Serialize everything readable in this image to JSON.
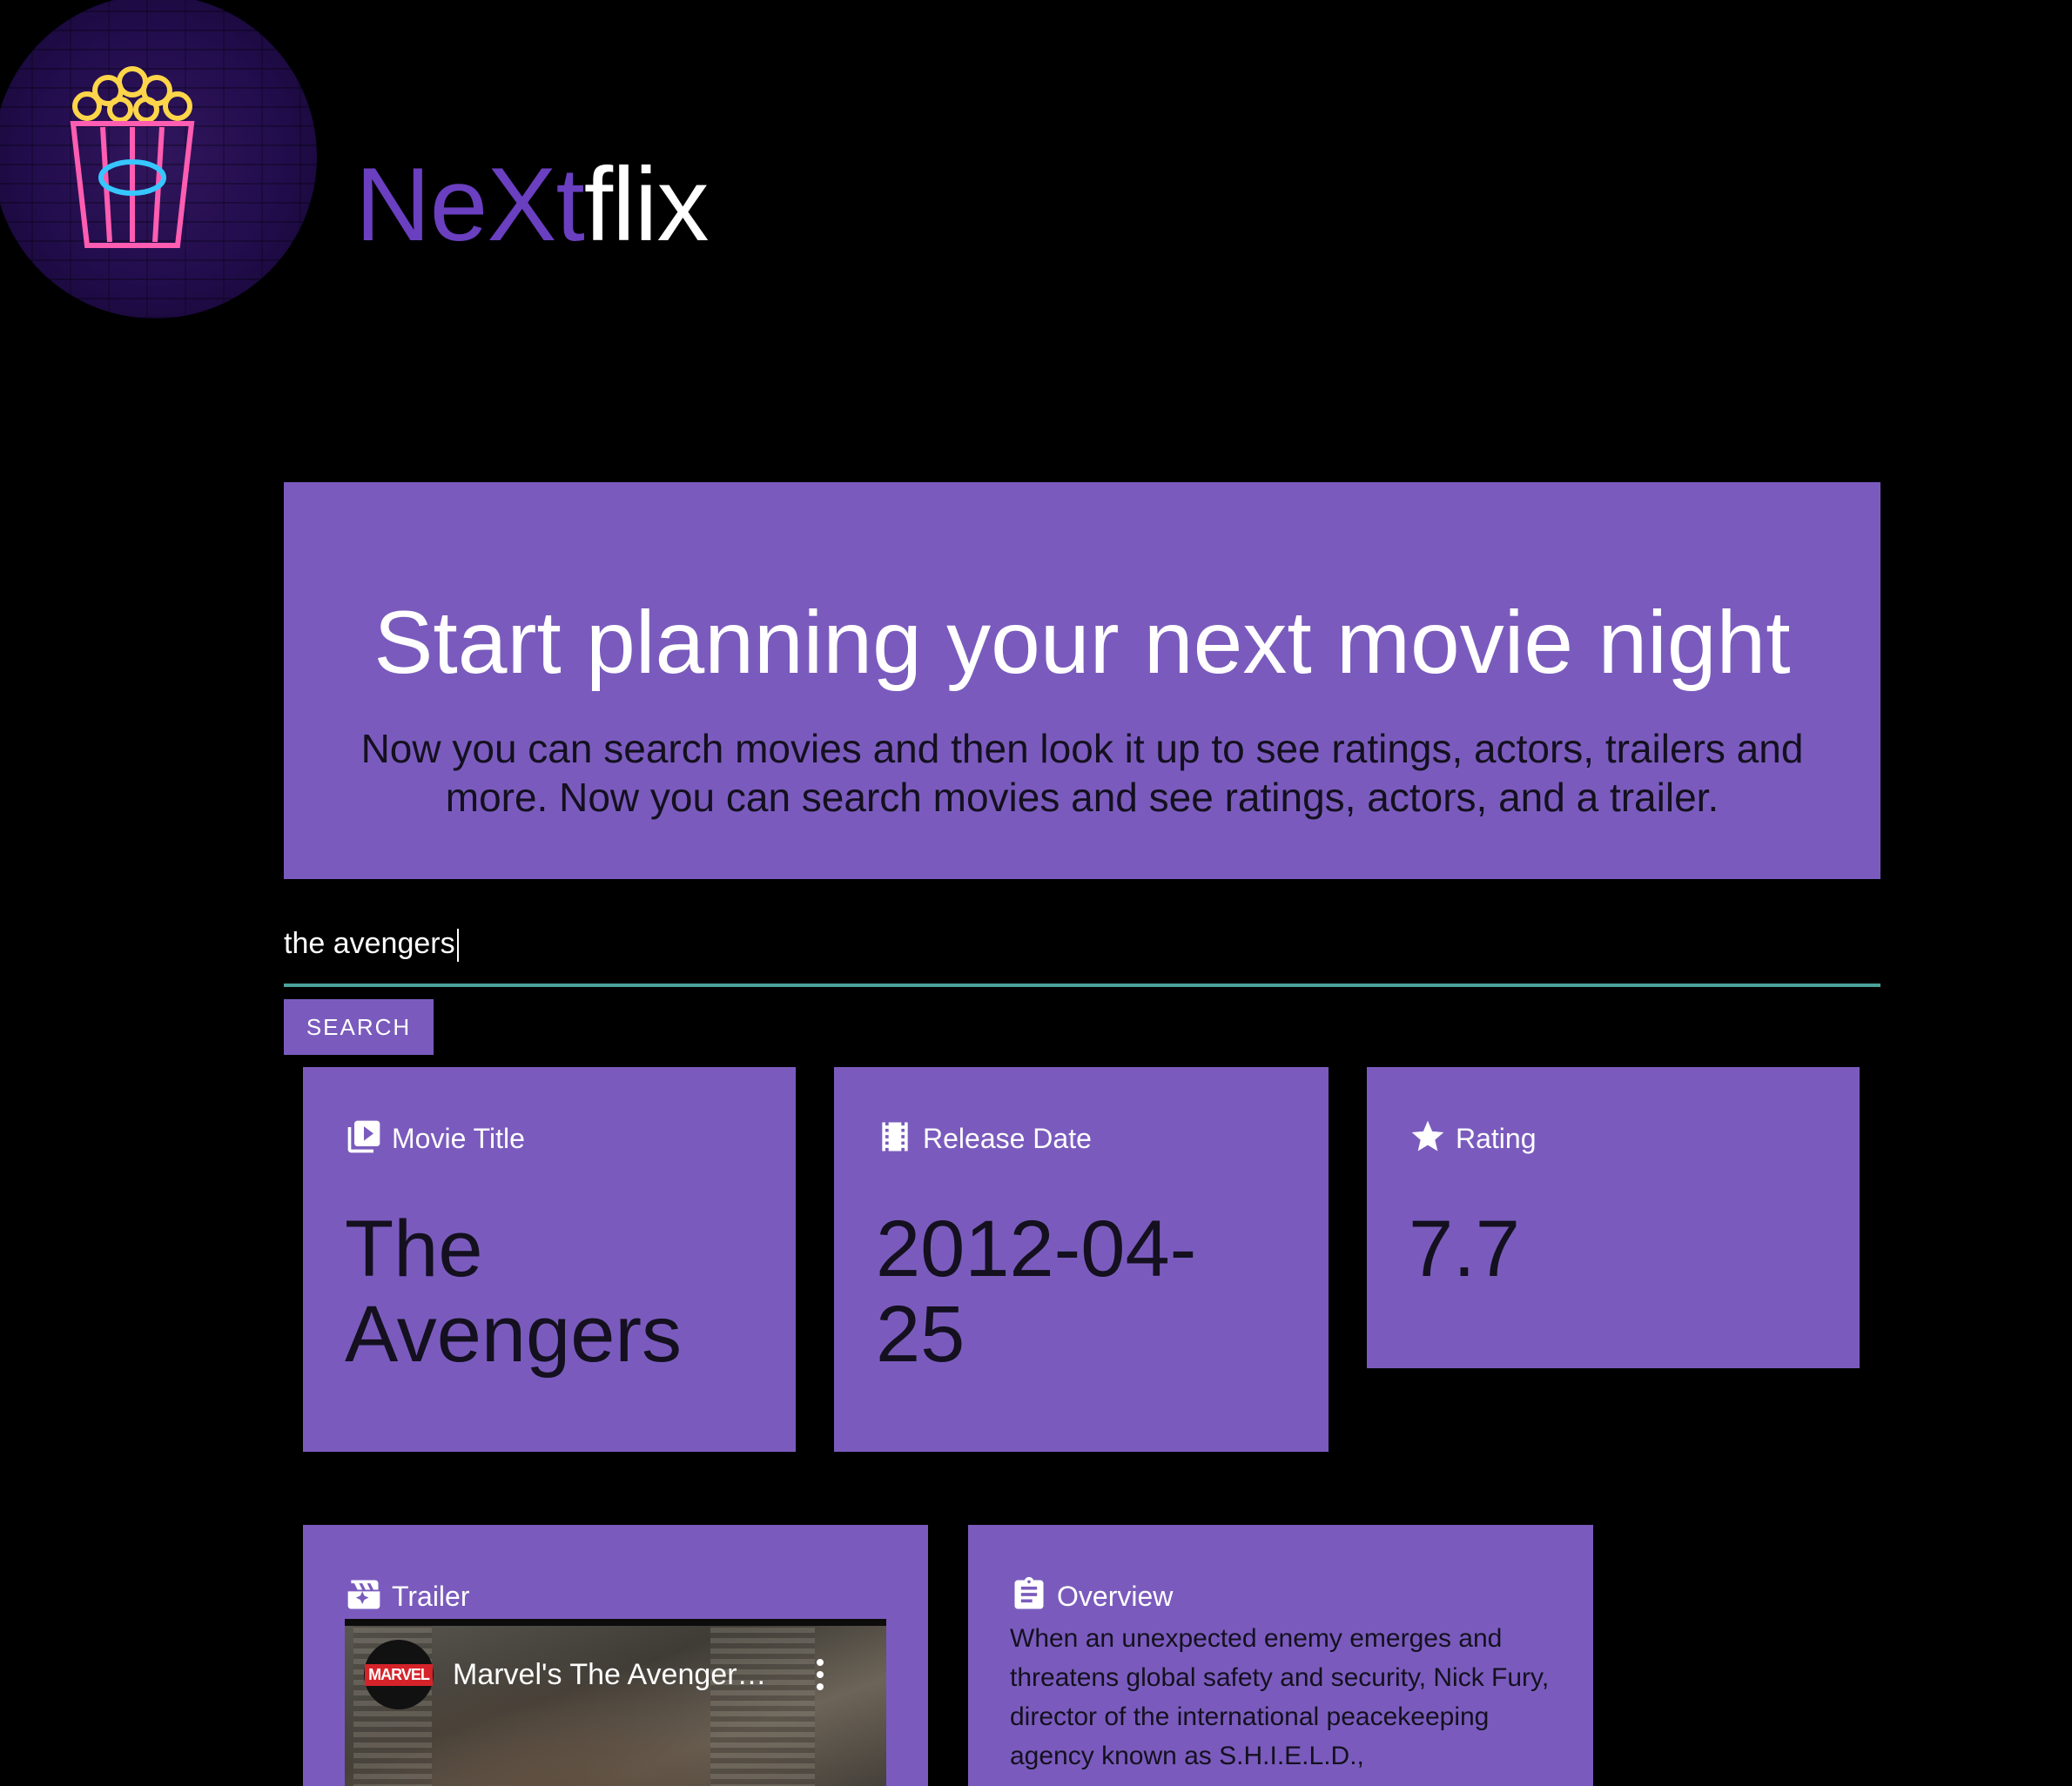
{
  "brand": {
    "part1": "NeXt",
    "part2": "flix"
  },
  "hero": {
    "heading": "Start planning your next movie night",
    "description": "Now you can search movies and then look it up to see ratings, actors, trailers and more. Now you can search movies and see ratings, actors, and a trailer."
  },
  "search": {
    "value": "the avengers",
    "button_label": "SEARCH"
  },
  "cards": {
    "title": {
      "label": "Movie Title",
      "icon": "video-library-icon",
      "value_line1": "The",
      "value_line2": "Avengers"
    },
    "release": {
      "label": "Release Date",
      "icon": "film-strip-icon",
      "value_line1": "2012-04-",
      "value_line2": "25"
    },
    "rating": {
      "label": "Rating",
      "icon": "star-icon",
      "value": "7.7"
    },
    "trailer": {
      "label": "Trailer",
      "icon": "movie-clapper-icon",
      "video_title": "Marvel's The Avengers",
      "channel": "MARVEL"
    },
    "overview": {
      "label": "Overview",
      "icon": "clipboard-icon",
      "text": "When an unexpected enemy emerges and threatens global safety and security, Nick Fury, director of the international peacekeeping agency known as S.H.I.E.L.D.,"
    }
  },
  "colors": {
    "background": "#000000",
    "card": "#7a5bbd",
    "brand_purple": "#6a3fc0",
    "search_underline": "#4aa39a",
    "dark_text": "#14101f"
  }
}
